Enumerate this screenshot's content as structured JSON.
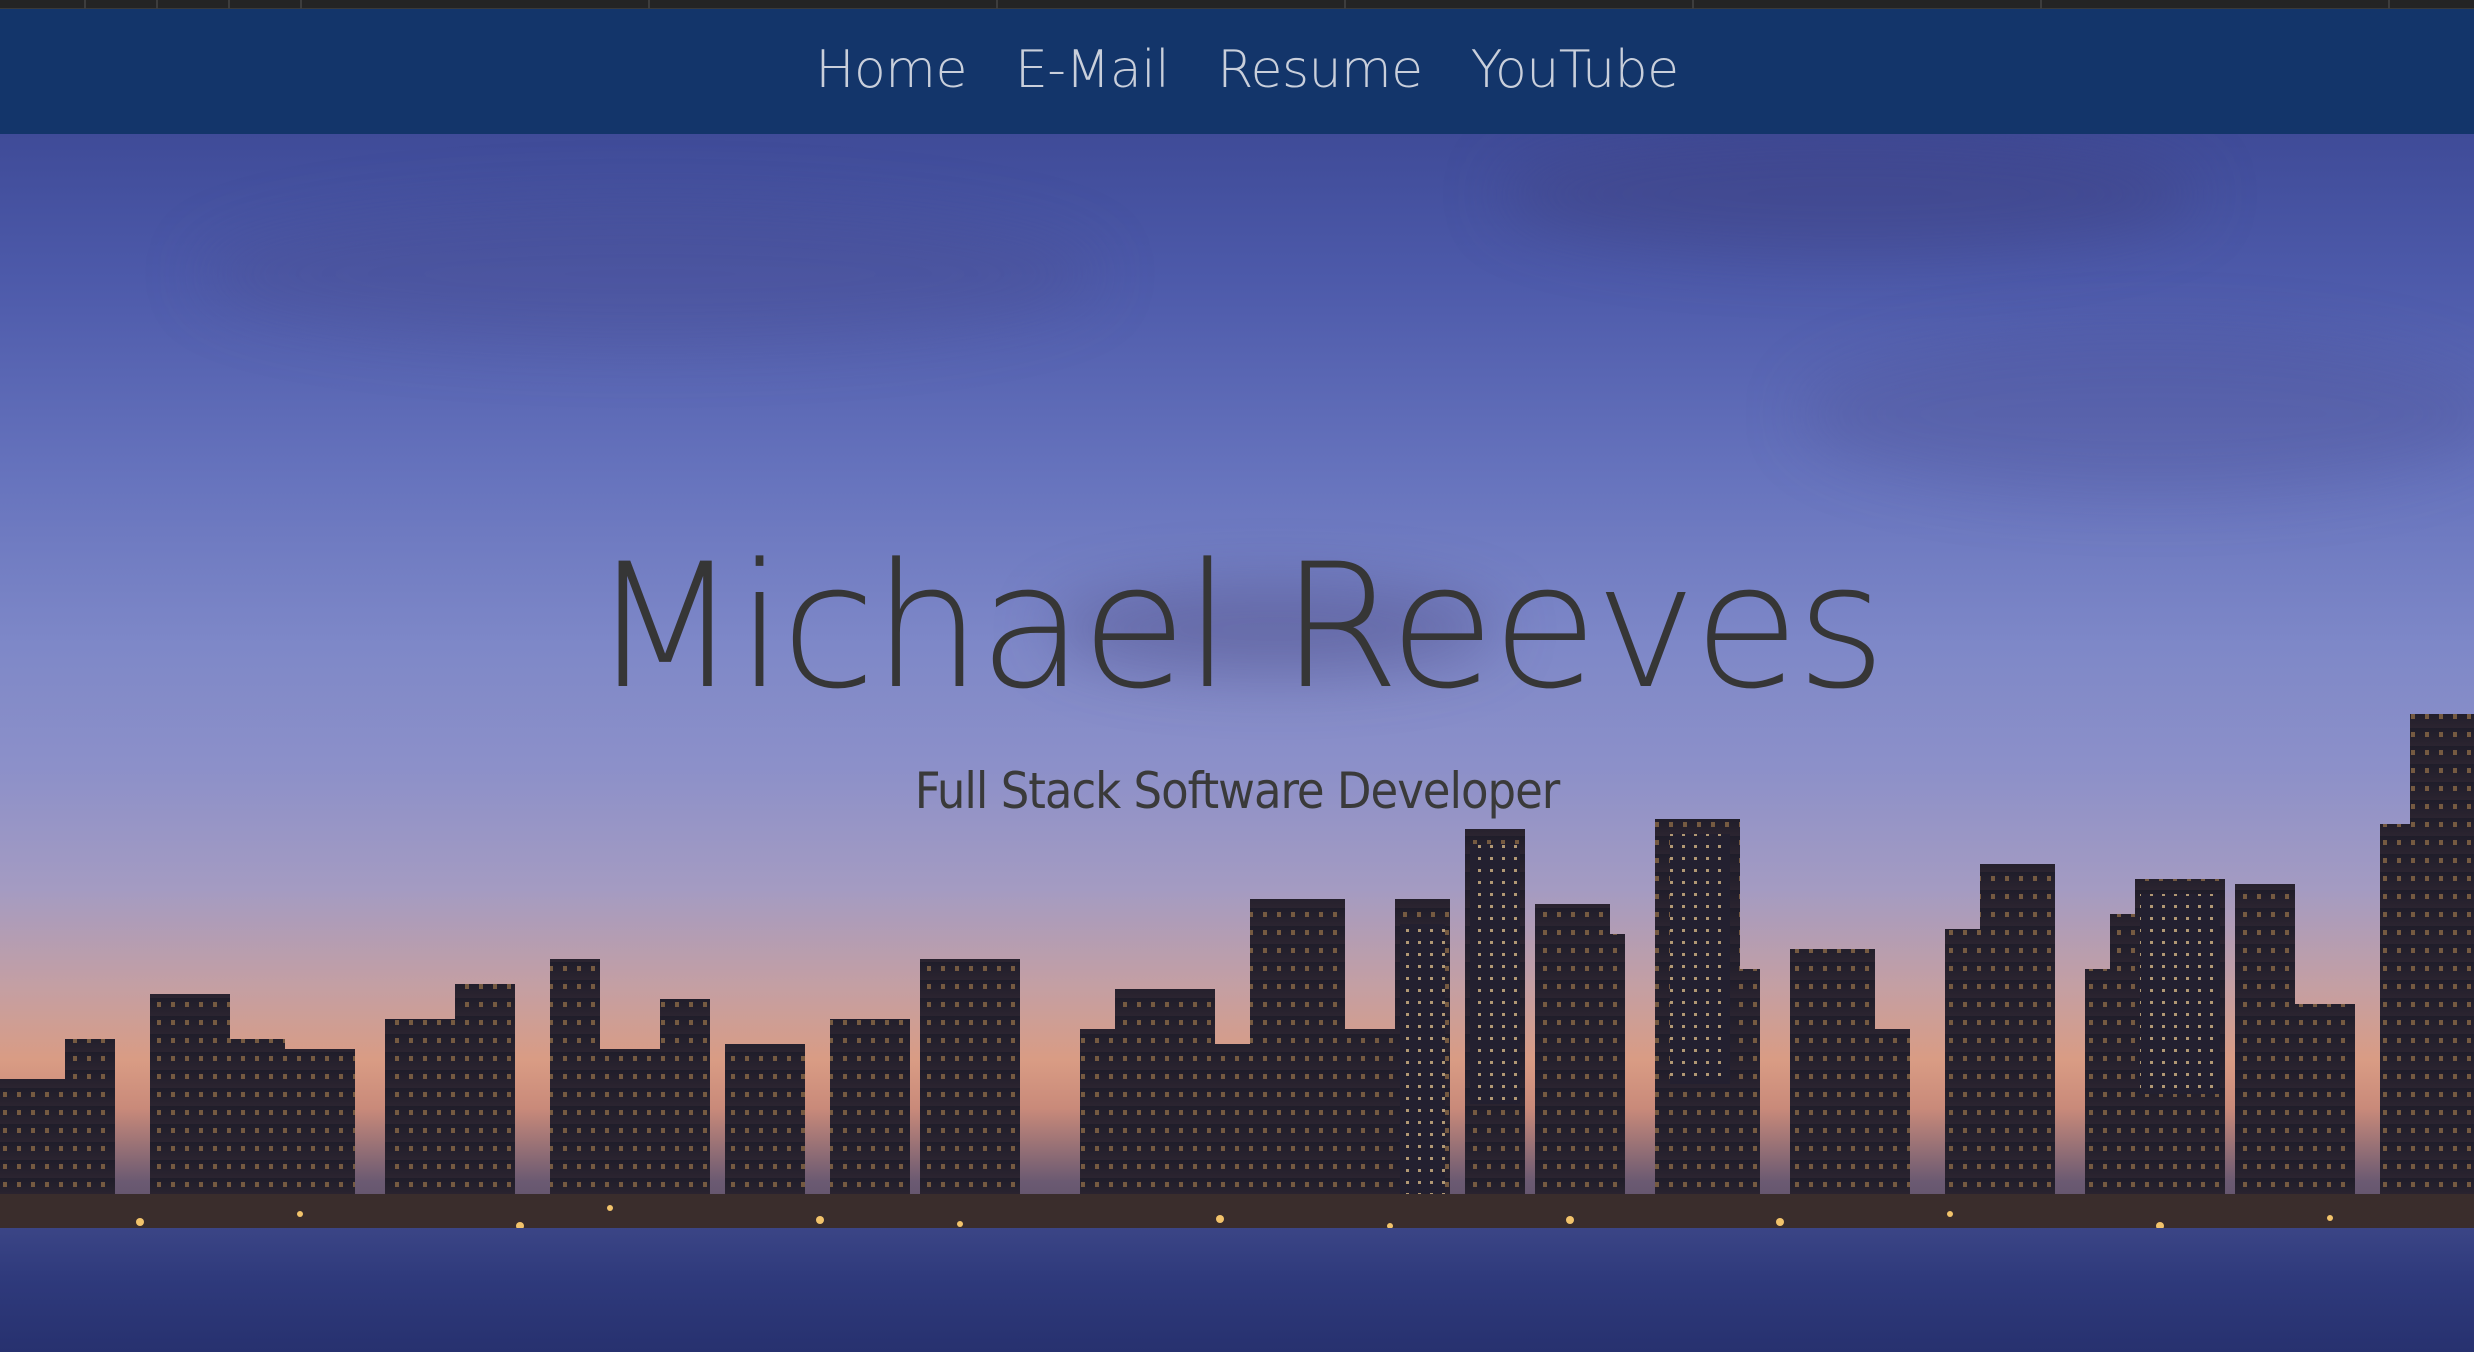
{
  "nav": {
    "items": [
      {
        "label": "Home"
      },
      {
        "label": "E-Mail"
      },
      {
        "label": "Resume"
      },
      {
        "label": "YouTube"
      }
    ]
  },
  "hero": {
    "name": "Michael Reeves",
    "tagline": "Full Stack Software Developer"
  },
  "colors": {
    "navbar_bg": "#13356a",
    "nav_text": "#c9cfdb",
    "hero_text": "#363636"
  }
}
